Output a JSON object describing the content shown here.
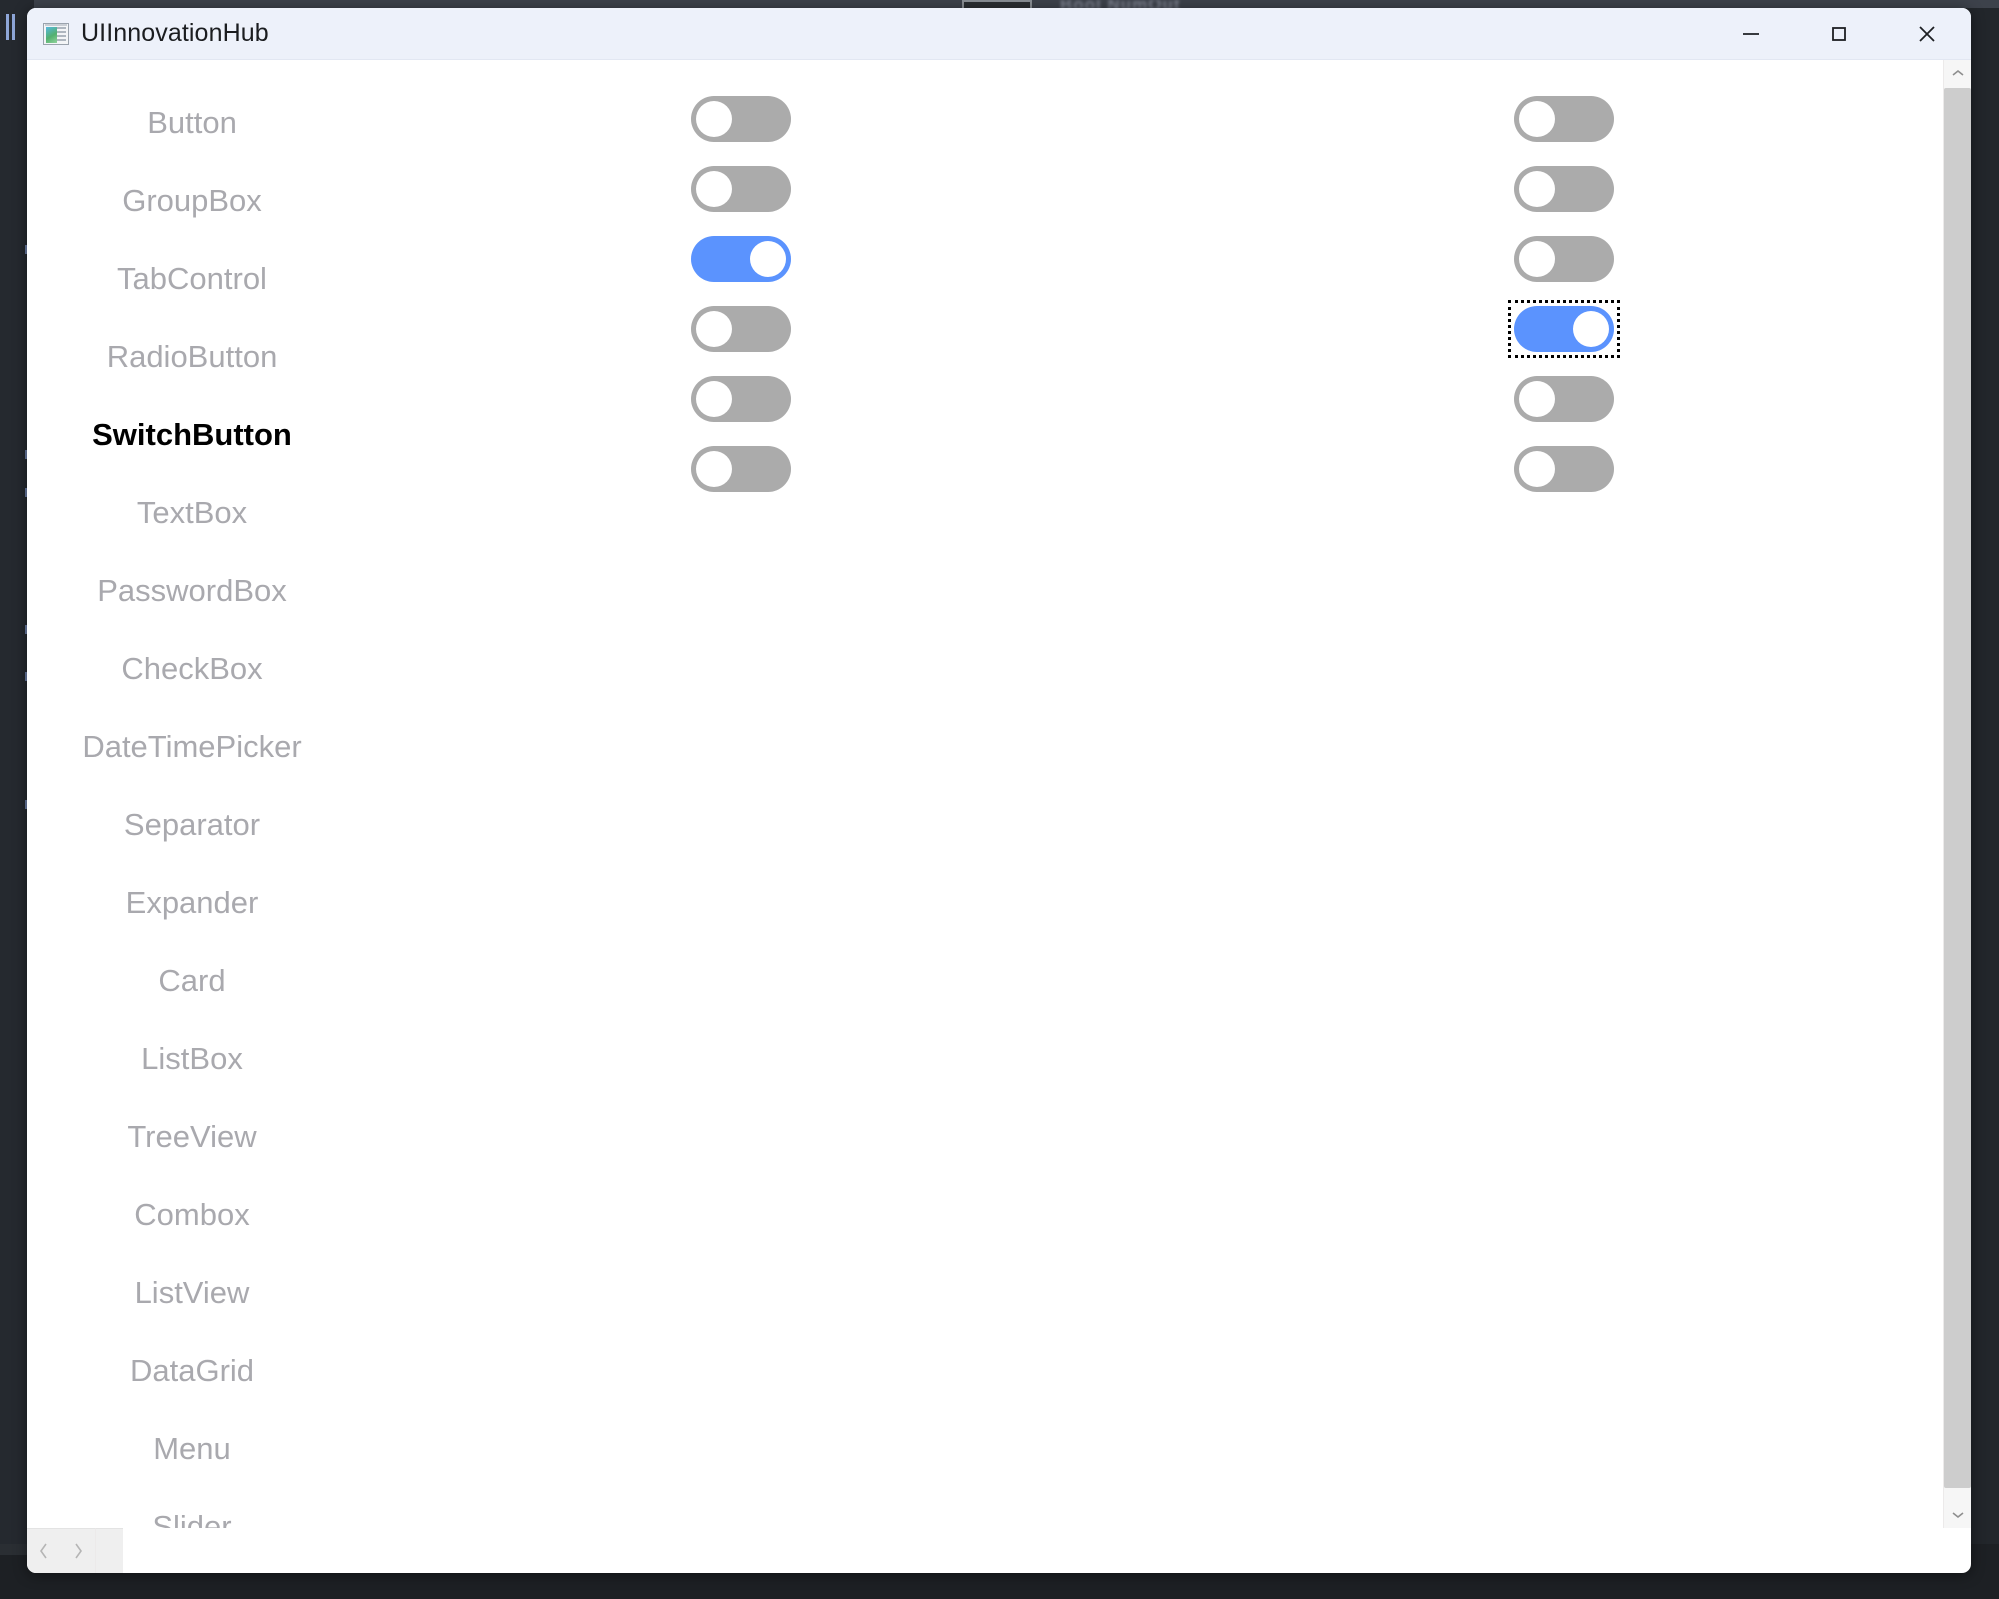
{
  "window": {
    "title": "UIInnovationHub",
    "icon": "app-window-icon",
    "controls": {
      "minimize": "minimize-icon",
      "maximize": "maximize-icon",
      "close": "close-icon"
    }
  },
  "background": {
    "ghost_text": "Bool NumOut",
    "chip": "menu-handle",
    "orange_glyph": "(;"
  },
  "nav": {
    "items": [
      {
        "label": "Button",
        "active": false
      },
      {
        "label": "GroupBox",
        "active": false
      },
      {
        "label": "TabControl",
        "active": false
      },
      {
        "label": "RadioButton",
        "active": false
      },
      {
        "label": "SwitchButton",
        "active": true
      },
      {
        "label": "TextBox",
        "active": false
      },
      {
        "label": "PasswordBox",
        "active": false
      },
      {
        "label": "CheckBox",
        "active": false
      },
      {
        "label": "DateTimePicker",
        "active": false
      },
      {
        "label": "Separator",
        "active": false
      },
      {
        "label": "Expander",
        "active": false
      },
      {
        "label": "Card",
        "active": false
      },
      {
        "label": "ListBox",
        "active": false
      },
      {
        "label": "TreeView",
        "active": false
      },
      {
        "label": "Combox",
        "active": false
      },
      {
        "label": "ListView",
        "active": false
      },
      {
        "label": "DataGrid",
        "active": false
      },
      {
        "label": "Menu",
        "active": false
      },
      {
        "label": "Slider",
        "active": false
      }
    ]
  },
  "switches": {
    "column_left": [
      {
        "name": "switch-left-1",
        "checked": false,
        "focused": false
      },
      {
        "name": "switch-left-2",
        "checked": false,
        "focused": false
      },
      {
        "name": "switch-left-3",
        "checked": true,
        "focused": false
      },
      {
        "name": "switch-left-4",
        "checked": false,
        "focused": false
      },
      {
        "name": "switch-left-5",
        "checked": false,
        "focused": false
      },
      {
        "name": "switch-left-6",
        "checked": false,
        "focused": false
      }
    ],
    "column_right": [
      {
        "name": "switch-right-1",
        "checked": false,
        "focused": false
      },
      {
        "name": "switch-right-2",
        "checked": false,
        "focused": false
      },
      {
        "name": "switch-right-3",
        "checked": false,
        "focused": false
      },
      {
        "name": "switch-right-4",
        "checked": true,
        "focused": true
      },
      {
        "name": "switch-right-5",
        "checked": false,
        "focused": false
      },
      {
        "name": "switch-right-6",
        "checked": false,
        "focused": false
      }
    ]
  },
  "scrollbars": {
    "vertical": {
      "up": "chevron-up-icon",
      "down": "chevron-down-icon",
      "thumb_position": "top"
    },
    "horizontal": {
      "left": "chevron-left-icon",
      "right": "chevron-right-icon"
    }
  },
  "colors": {
    "accent_on": "#5B93FE",
    "switch_off": "#ABABAB",
    "titlebar": "#EDF1FA",
    "nav_inactive_text": "#A9A9AE",
    "nav_active_text": "#000000",
    "desktop": "#22262B"
  }
}
